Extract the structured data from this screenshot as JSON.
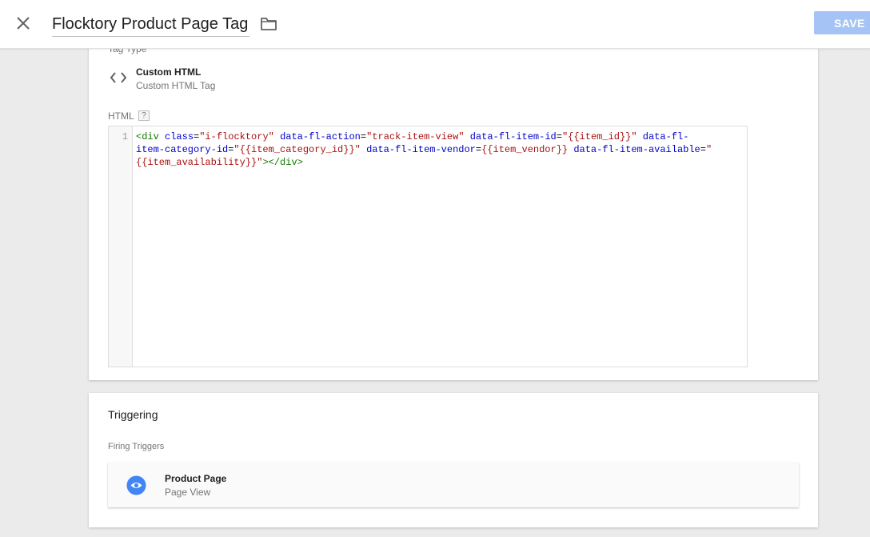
{
  "header": {
    "title": "Flocktory Product Page Tag",
    "save_label": "SAVE"
  },
  "tag_config": {
    "cut_off_label": "Tag Type",
    "tag_type_name": "Custom HTML",
    "tag_type_subtitle": "Custom HTML Tag",
    "html_label": "HTML",
    "help_label": "?",
    "line_number": "1",
    "code": {
      "t1": "<div",
      "a1": "class",
      "e1": "=",
      "s1": "\"i-flocktory\"",
      "a2": "data-fl-action",
      "e2": "=",
      "s2": "\"track-item-view\"",
      "a3": "data-fl-item-id",
      "e3": "=",
      "s3": "\"{{item_id}}\"",
      "a4a": "data-fl-",
      "a4b": "item-category-id",
      "e4": "=",
      "s4": "\"{{item_category_id}}\"",
      "a5": "data-fl-item-vendor",
      "e5": "=",
      "s5": "{{item_vendor}}",
      "a6": "data-fl-item-available",
      "e6": "=",
      "s6a": "\"",
      "s6b": "{{item_availability}}\"",
      "t2": "></div>"
    }
  },
  "triggering": {
    "title": "Triggering",
    "firing_label": "Firing Triggers",
    "trigger_name": "Product Page",
    "trigger_type": "Page View"
  },
  "colors": {
    "save_button_bg": "#a5c4f5",
    "trigger_icon": "#4285f4",
    "code_tag": "#117700",
    "code_attr": "#0000cc",
    "code_string": "#aa1111"
  },
  "icons": [
    "close-icon",
    "folder-icon",
    "code-icon",
    "help-icon",
    "eye-icon"
  ]
}
